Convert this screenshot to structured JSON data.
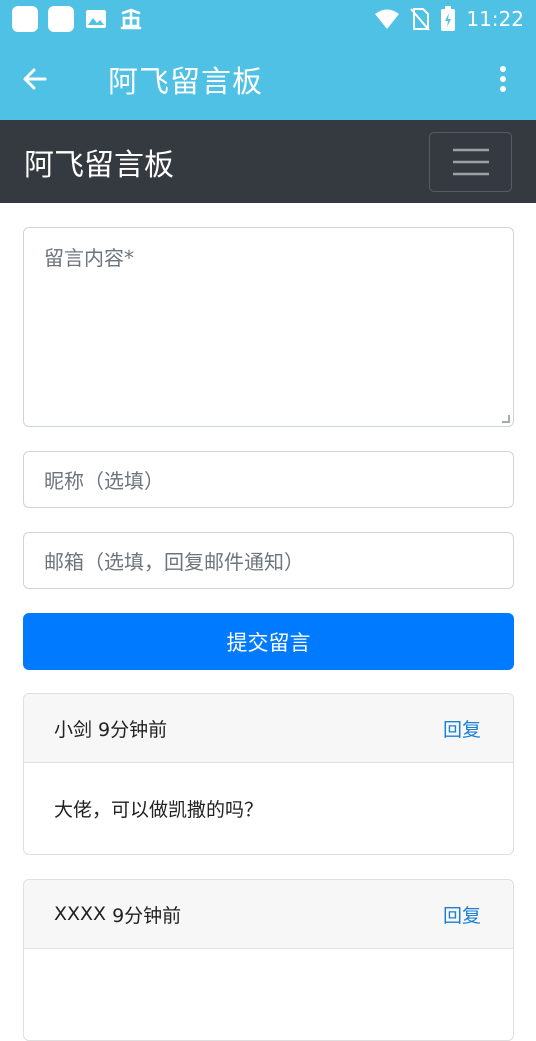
{
  "status_bar": {
    "time": "11:22",
    "icons": [
      "notification-square-icon",
      "notification-square-icon",
      "image-icon",
      "bug-icon",
      "wifi-icon",
      "no-sim-icon",
      "battery-icon"
    ]
  },
  "app_bar": {
    "title": "阿飞留言板",
    "back_icon": "arrow-left-icon",
    "more_icon": "more-vert-icon"
  },
  "navbar": {
    "brand": "阿飞留言板",
    "toggler_icon": "hamburger-icon"
  },
  "form": {
    "content_placeholder": "留言内容*",
    "nickname_placeholder": "昵称（选填）",
    "email_placeholder": "邮箱（选填，回复邮件通知）",
    "submit_label": "提交留言"
  },
  "messages": [
    {
      "author": "小剑",
      "time": "9分钟前",
      "reply_label": "回复",
      "content": "大佬，可以做凯撒的吗？"
    },
    {
      "author": "XXXX",
      "time": "9分钟前",
      "reply_label": "回复",
      "content": ""
    }
  ],
  "colors": {
    "app_bar": "#4fc1e5",
    "navbar": "#343a40",
    "primary": "#007bff",
    "link": "#1a7fd6"
  }
}
